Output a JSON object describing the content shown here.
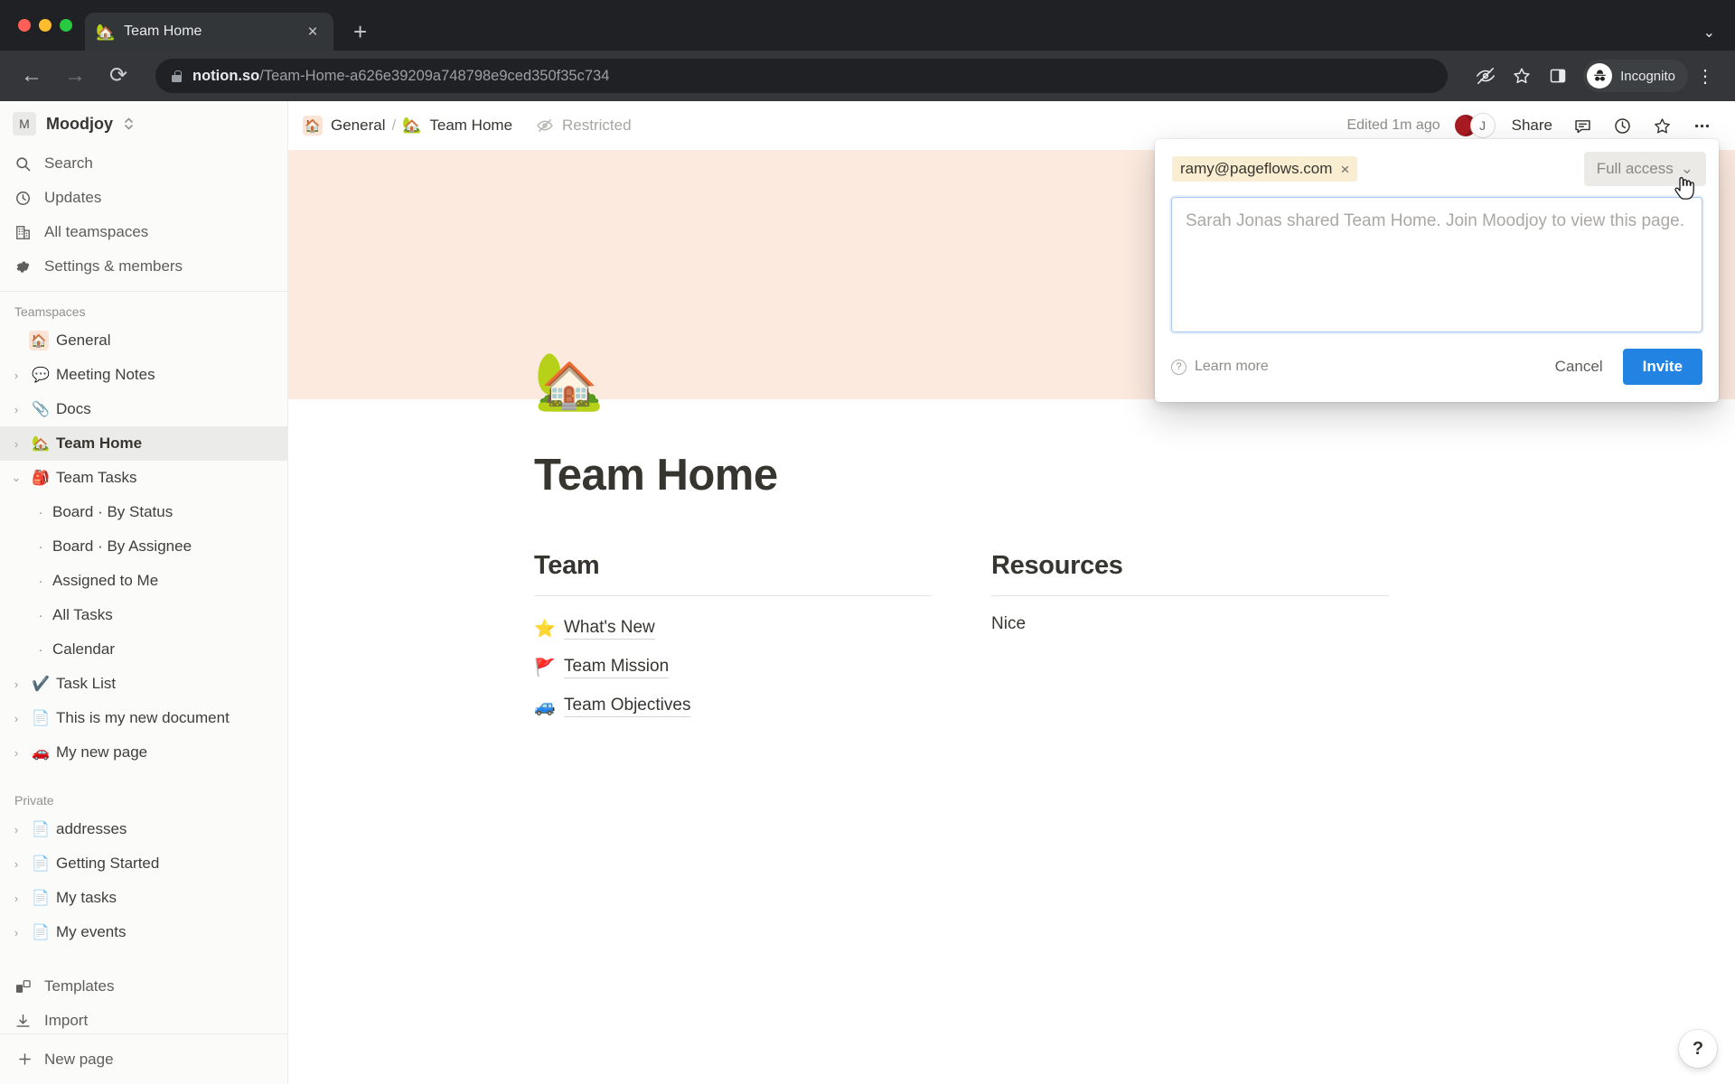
{
  "browser": {
    "tab": {
      "title": "Team Home",
      "favicon": "house-emoji",
      "close_label": "×"
    },
    "new_tab_label": "+",
    "tab_list_chevron": "⌄",
    "nav": {
      "back": "←",
      "forward": "→",
      "reload": "⟳"
    },
    "omnibox": {
      "domain": "notion.so",
      "path": "/Team-Home-a626e39209a748798e9ced350f35c734"
    },
    "toolbar_icons": [
      "eye-off-icon",
      "star-icon",
      "side-panel-icon"
    ],
    "profile": {
      "label": "Incognito",
      "icon": "incognito-icon"
    },
    "menu_label": "⋮"
  },
  "sidebar": {
    "workspace": {
      "initial": "M",
      "name": "Moodjoy"
    },
    "quick_items": [
      {
        "label": "Search",
        "icon": "search-icon"
      },
      {
        "label": "Updates",
        "icon": "clock-icon"
      },
      {
        "label": "All teamspaces",
        "icon": "building-icon"
      },
      {
        "label": "Settings & members",
        "icon": "gear-icon"
      }
    ],
    "teamspaces_header": "Teamspaces",
    "teamspaces": [
      {
        "label": "General",
        "emoji": "🏠",
        "boxed": true,
        "twisty": false,
        "expanded": false,
        "active": false,
        "bold": false
      },
      {
        "label": "Meeting Notes",
        "emoji": "💬",
        "twisty": true,
        "expanded": false,
        "active": false,
        "bold": false
      },
      {
        "label": "Docs",
        "emoji": "📎",
        "twisty": true,
        "expanded": false,
        "active": false,
        "bold": false
      },
      {
        "label": "Team Home",
        "emoji": "🏡",
        "twisty": true,
        "expanded": false,
        "active": true,
        "bold": true
      },
      {
        "label": "Team Tasks",
        "emoji": "🎒",
        "twisty": true,
        "expanded": true,
        "active": false,
        "bold": false
      }
    ],
    "team_tasks_children": [
      {
        "label": "Board · By Status"
      },
      {
        "label": "Board · By Assignee"
      },
      {
        "label": "Assigned to Me"
      },
      {
        "label": "All Tasks"
      },
      {
        "label": "Calendar"
      }
    ],
    "teamspaces_tail": [
      {
        "label": "Task List",
        "emoji": "✔️",
        "twisty": true
      },
      {
        "label": "This is my new document",
        "emoji": "📄",
        "twisty": true
      },
      {
        "label": "My new page",
        "emoji": "🚗",
        "twisty": true
      }
    ],
    "private_header": "Private",
    "private": [
      {
        "label": "addresses",
        "emoji": "📄",
        "twisty": true
      },
      {
        "label": "Getting Started",
        "emoji": "📄",
        "twisty": true
      },
      {
        "label": "My tasks",
        "emoji": "📄",
        "twisty": true
      },
      {
        "label": "My events",
        "emoji": "📄",
        "twisty": true
      }
    ],
    "utilities": [
      {
        "label": "Templates",
        "icon": "templates-icon"
      },
      {
        "label": "Import",
        "icon": "import-icon"
      }
    ],
    "footer": {
      "label": "New page",
      "icon": "plus-icon"
    }
  },
  "topbar": {
    "breadcrumb": [
      {
        "label": "General",
        "emoji": "🏠",
        "boxed": true
      },
      {
        "label": "Team Home",
        "emoji": "🏡",
        "boxed": false
      }
    ],
    "separator": "/",
    "restricted_label": "Restricted",
    "restricted_icon": "eye-off-icon",
    "edited_label": "Edited 1m ago",
    "avatars": [
      {
        "name": "mug-avatar",
        "initial": "",
        "emoji": "☕"
      },
      {
        "name": "j-avatar",
        "initial": "J"
      }
    ],
    "share_label": "Share",
    "icons": [
      "comment-icon",
      "history-icon",
      "star-icon",
      "more-icon"
    ]
  },
  "page": {
    "cover_color": "#fceadf",
    "emoji": "🏡",
    "title": "Team Home",
    "columns": [
      {
        "heading": "Team",
        "links": [
          {
            "emoji": "⭐",
            "label": "What's New"
          },
          {
            "emoji": "🚩",
            "label": "Team Mission"
          },
          {
            "emoji": "🚙",
            "label": "Team Objectives"
          }
        ],
        "text": ""
      },
      {
        "heading": "Resources",
        "links": [],
        "text": "Nice"
      }
    ]
  },
  "share_popup": {
    "chip": {
      "email": "ramy@pageflows.com",
      "remove": "×"
    },
    "access": {
      "label": "Full access",
      "chevron": "⌄"
    },
    "message_placeholder": "Sarah Jonas shared Team Home. Join Moodjoy to view this page.",
    "learn_more": "Learn more",
    "cancel": "Cancel",
    "invite": "Invite",
    "accent_color": "#2383e2"
  },
  "help_button": {
    "label": "?"
  }
}
